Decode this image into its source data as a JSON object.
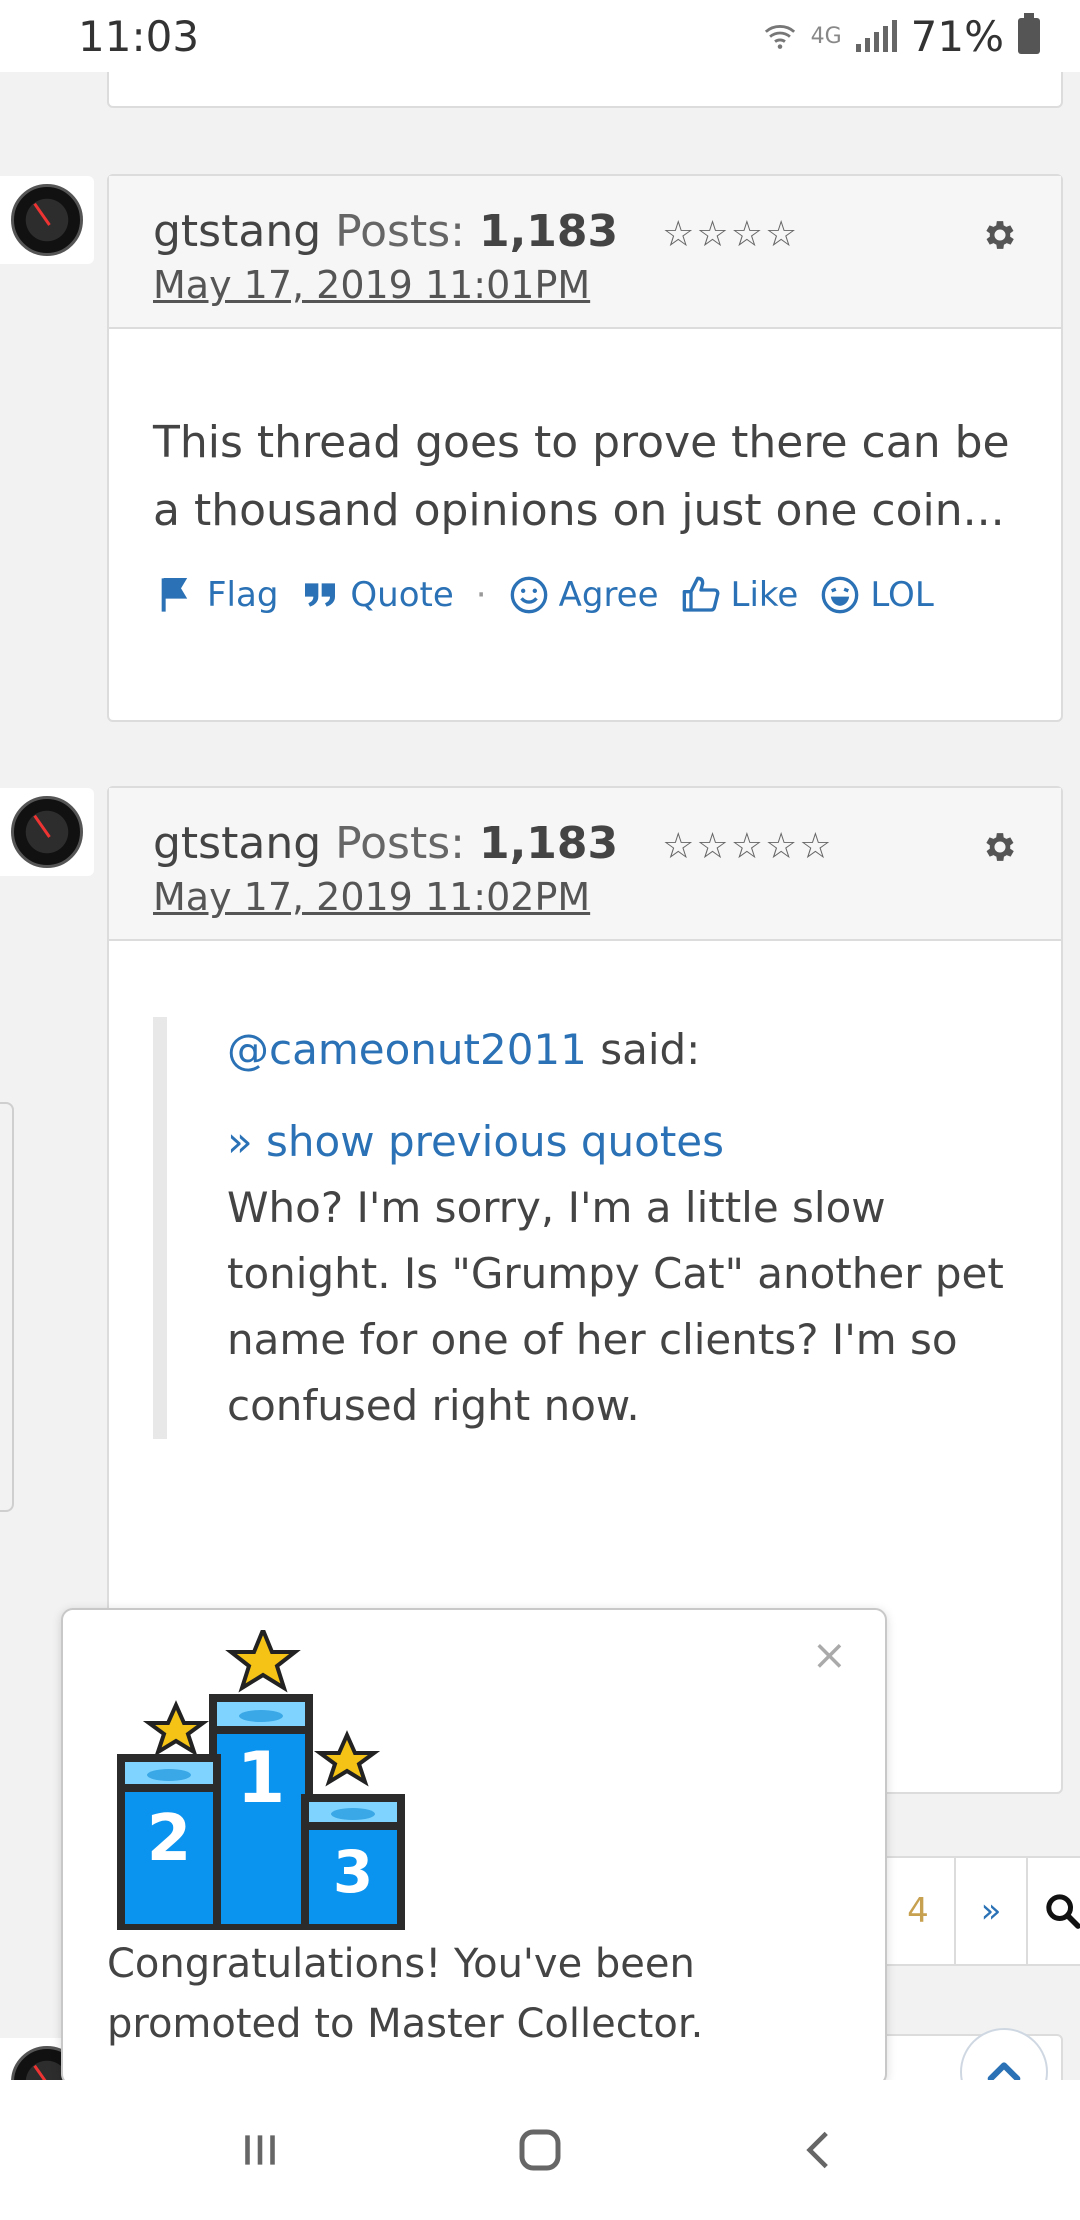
{
  "status_bar": {
    "time": "11:03",
    "network": "4G",
    "battery": "71%"
  },
  "posts": [
    {
      "author": "gtstang",
      "posts_label": "Posts:",
      "posts_count": "1,183",
      "stars": "☆☆☆☆",
      "date": "May 17, 2019 11:01PM",
      "body": "This thread goes to prove there can be a thousand opinions on just one coin...",
      "actions": {
        "flag": "Flag",
        "quote": "Quote",
        "separator": "·",
        "agree": "Agree",
        "like": "Like",
        "lol": "LOL"
      }
    },
    {
      "author": "gtstang",
      "posts_label": "Posts:",
      "posts_count": "1,183",
      "stars": "☆☆☆☆☆",
      "date": "May 17, 2019 11:02PM",
      "quote": {
        "mention": "@cameonut2011",
        "said": " said:",
        "show_previous": "» show previous quotes",
        "text": "Who? I'm sorry, I'm a little slow tonight. Is \"Grumpy Cat\" another pet name for one of her clients? I'm so confused right now."
      }
    }
  ],
  "pager": {
    "partial_page": "4",
    "next": "»"
  },
  "toast": {
    "close": "×",
    "message": "Congratulations! You've been promoted to Master Collector."
  },
  "colors": {
    "link": "#2a72b5",
    "podium_blue": "#0a93ef",
    "star_gold": "#f4c316"
  }
}
